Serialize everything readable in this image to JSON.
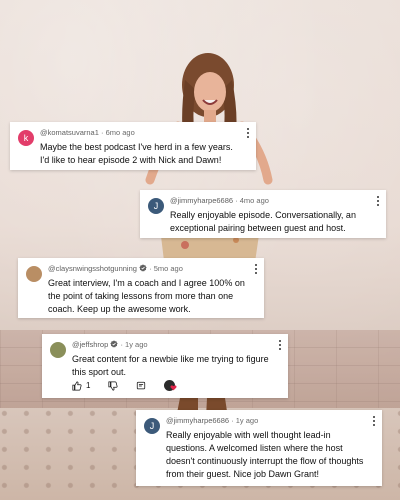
{
  "comments": [
    {
      "handle": "@komatsuvarna1",
      "time": "6mo ago",
      "text": "Maybe the best podcast I've herd in a few years. I'd like to hear episode 2 with Nick and Dawn!",
      "avatar_letter": "k",
      "avatar_color": "#e23d6a"
    },
    {
      "handle": "@jimmyharpe6686",
      "time": "4mo ago",
      "text": "Really enjoyable episode.  Conversationally, an exceptional pairing between guest and host.",
      "avatar_letter": "J",
      "avatar_color": "#3c5a7a"
    },
    {
      "handle": "@claysnwingsshotgunning",
      "time": "5mo ago",
      "text": "Great interview, I'm a coach and I agree 100% on the point of taking lessons from more than one coach.  Keep up the awesome work.",
      "avatar_color": "#b98e64"
    },
    {
      "handle": "@jeffshrop",
      "time": "1y ago",
      "text": "Great content for a newbie like me trying to figure this sport out.",
      "avatar_color": "#8a8f5a",
      "like_count": "1"
    },
    {
      "handle": "@jimmyharpe6686",
      "time": "1y ago",
      "text": "Really enjoyable with well thought lead-in questions. A welcomed listen where the host doesn't continuously interrupt the flow of thoughts from their guest.  Nice job Dawn Grant!",
      "avatar_letter": "J",
      "avatar_color": "#3c5a7a"
    }
  ],
  "separator": "·",
  "icons": [
    "more-vertical-icon",
    "verified-icon",
    "thumbs-up-icon",
    "thumbs-down-icon",
    "reply-icon",
    "creator-heart-icon"
  ]
}
